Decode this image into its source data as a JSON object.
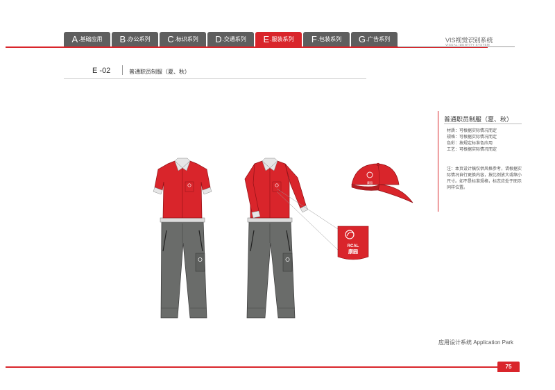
{
  "tabs": [
    {
      "letter": "A",
      "label": ".基础应用"
    },
    {
      "letter": "B",
      "label": ".办公系列"
    },
    {
      "letter": "C",
      "label": ".标识系列"
    },
    {
      "letter": "D",
      "label": ".交通系列"
    },
    {
      "letter": "E",
      "label": ".服装系列",
      "active": true
    },
    {
      "letter": "F",
      "label": ".包装系列"
    },
    {
      "letter": "G",
      "label": ".广告系列"
    }
  ],
  "header": {
    "title": "VIS视觉识别系统",
    "subtitle": "VISUAL IDENTITY SYSTEM"
  },
  "section": {
    "letter": "E",
    "number": "-02",
    "title": "普通职员制服（夏、秋）"
  },
  "description": {
    "title": "普通职员制服（夏、秋）",
    "specs": [
      "材质：可根据实际情况而定",
      "规格：可根据实际情况而定",
      "色彩：按规定标准色应用",
      "工艺：可根据实际情况而定"
    ],
    "note": "注：本页设计稿仅供风格参考，请根据实际情况自行更换内容，按比例放大或缩小尺寸。如不是标准规格，标志应处于图示同样位置。"
  },
  "logo": {
    "text_en": "RCAL",
    "text_cn": "康园"
  },
  "footer": {
    "caption": "应用设计系统  Application Park",
    "page": "75"
  },
  "colors": {
    "brand_red": "#d9252b",
    "tab_grey": "#5e5e5e",
    "pants_grey": "#6a6c6a"
  }
}
